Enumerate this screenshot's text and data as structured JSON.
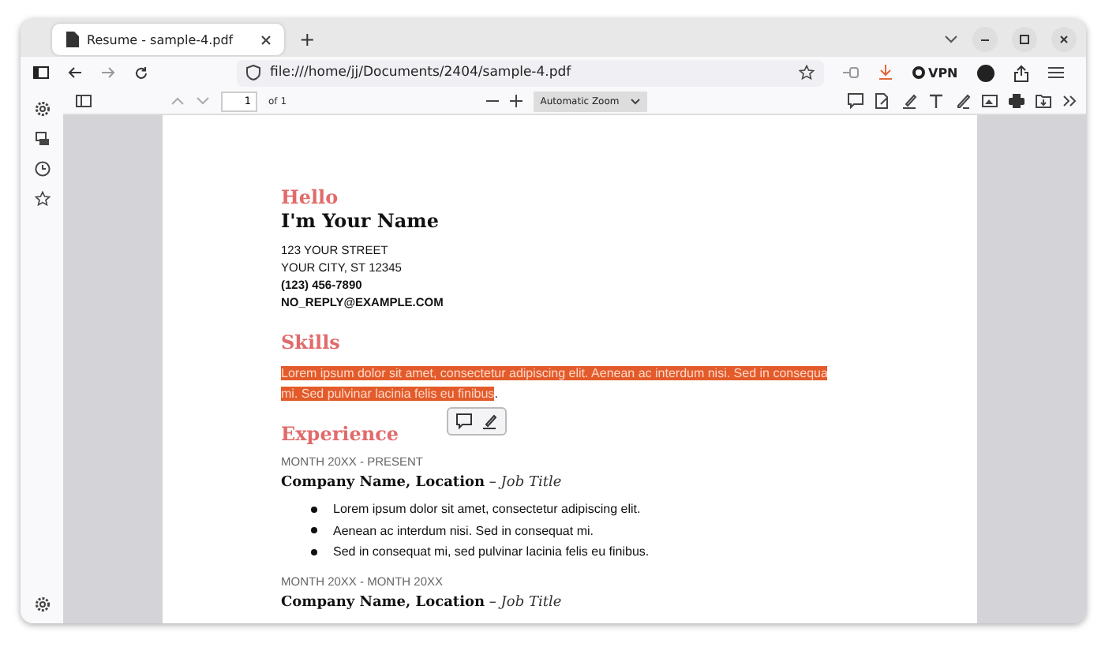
{
  "browser": {
    "tabs": [
      {
        "title": "Resume - sample-4.pdf",
        "selected": true
      }
    ],
    "new_tab": "+",
    "url": "file:///home/jj/Documents/2404/sample-4.pdf",
    "vpn": "VPN"
  },
  "pdf_toolbar": {
    "page_number": "1",
    "page_count": "of 1",
    "zoom": "Automatic Zoom"
  },
  "document": {
    "greeting": "Hello",
    "name": "I'm Your Name",
    "contact": [
      {
        "text": "123 YOUR STREET",
        "bold": false
      },
      {
        "text": "YOUR CITY, ST 12345",
        "bold": false
      },
      {
        "text": "(123) 456-7890",
        "bold": true
      },
      {
        "text": "NO_REPLY@EXAMPLE.COM",
        "bold": true
      }
    ],
    "skills_heading": "Skills",
    "skills_lines": [
      {
        "text": "Lorem ipsum dolor sit amet, consectetur adipiscing elit. Aenean ac interdum nisi. Sed in consequa",
        "selected": true
      },
      {
        "text": "mi. Sed pulvinar lacinia felis eu finibus",
        "tail": ".",
        "selected": true
      }
    ],
    "experience_heading": "Experience",
    "jobs": [
      {
        "dates": "MONTH 20XX - PRESENT",
        "company": "Company Name, Location",
        "dash": "–",
        "title": "Job Title",
        "bullets": [
          "Lorem ipsum dolor sit amet, consectetur adipiscing elit.",
          "Aenean ac interdum nisi. Sed in consequat mi.",
          "Sed in consequat mi, sed pulvinar lacinia felis eu finibus."
        ]
      },
      {
        "dates": "MONTH 20XX - MONTH 20XX",
        "company": "Company Name, Location",
        "dash": "–",
        "title": "Job Title"
      }
    ]
  }
}
